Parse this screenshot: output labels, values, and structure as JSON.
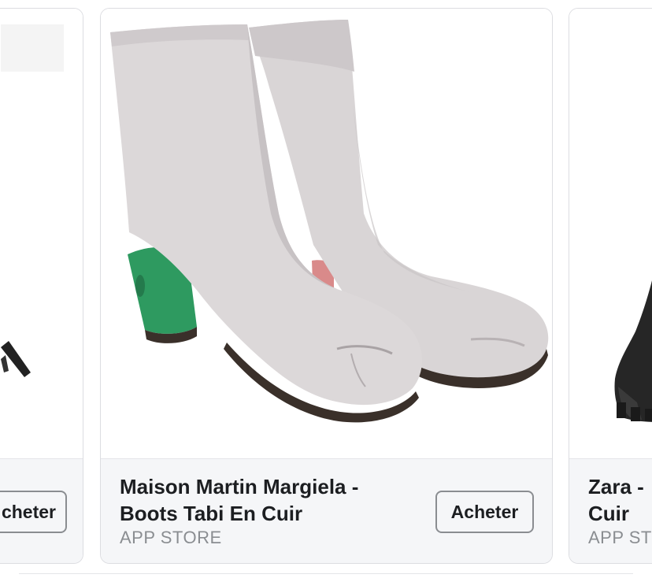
{
  "cards": [
    {
      "id": "left",
      "title": "",
      "source": "",
      "button_label": "cheter"
    },
    {
      "id": "center",
      "title": "Maison Martin Margiela -\nBoots Tabi En Cuir",
      "source": "APP STORE",
      "button_label": "Acheter",
      "image_icon": "tabi-boots-image"
    },
    {
      "id": "right",
      "title": "Zara -\nCuir",
      "source": "APP ST",
      "button_label": "",
      "image_icon": "black-boot-image"
    }
  ],
  "colors": {
    "card_border": "#dcdde1",
    "footer_bg": "#f5f6f8",
    "title_text": "#1c1e21",
    "source_text": "#8a8d91",
    "boot_leather": "#d9d5d6",
    "heel_green": "#2e9a60",
    "heel_pink": "#d98a8a"
  }
}
